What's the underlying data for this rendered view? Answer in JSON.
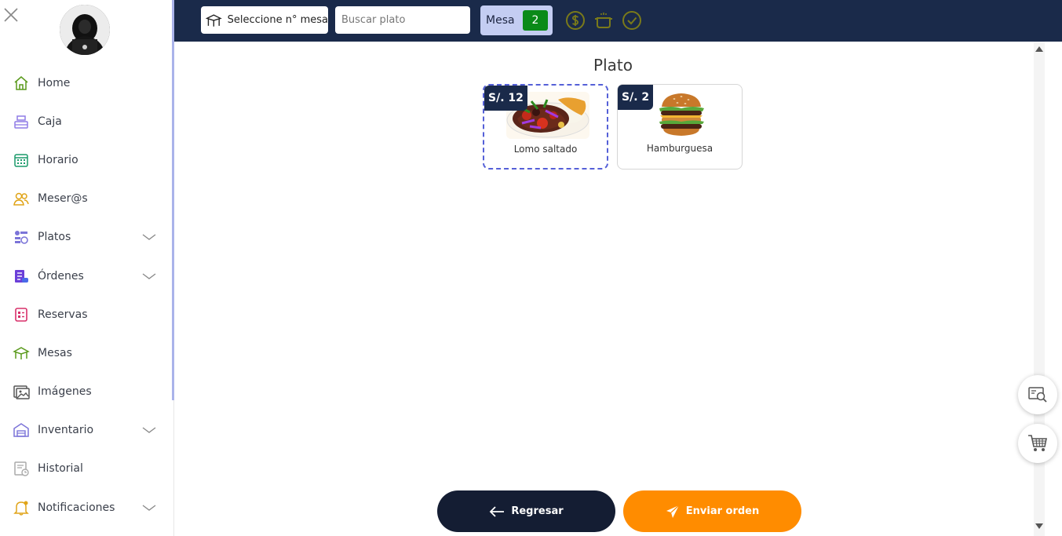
{
  "sidebar": {
    "items": [
      {
        "label": "Home",
        "icon": "home-icon",
        "expandable": false
      },
      {
        "label": "Caja",
        "icon": "cash-register-icon",
        "expandable": false
      },
      {
        "label": "Horario",
        "icon": "calendar-icon",
        "expandable": false
      },
      {
        "label": "Meser@s",
        "icon": "users-icon",
        "expandable": false
      },
      {
        "label": "Platos",
        "icon": "dishes-icon",
        "expandable": true
      },
      {
        "label": "Órdenes",
        "icon": "orders-icon",
        "expandable": true
      },
      {
        "label": "Reservas",
        "icon": "reservations-icon",
        "expandable": false
      },
      {
        "label": "Mesas",
        "icon": "table-icon",
        "expandable": false
      },
      {
        "label": "Imágenes",
        "icon": "images-icon",
        "expandable": false
      },
      {
        "label": "Inventario",
        "icon": "warehouse-icon",
        "expandable": true
      },
      {
        "label": "Historial",
        "icon": "history-icon",
        "expandable": false
      },
      {
        "label": "Notificaciones",
        "icon": "bell-icon",
        "expandable": true
      }
    ]
  },
  "topbar": {
    "table_select_label": "Seleccione n° mesa",
    "search_placeholder": "Buscar plato",
    "mesa_label": "Mesa",
    "mesa_number": "2",
    "status_icons": [
      "dollar-icon",
      "pot-icon",
      "check-circle-icon"
    ]
  },
  "main": {
    "section_title": "Plato",
    "dishes": [
      {
        "price": "S/. 12",
        "name": "Lomo saltado",
        "selected": true
      },
      {
        "price": "S/. 2",
        "name": "Hamburguesa",
        "selected": false
      }
    ],
    "back_label": "Regresar",
    "send_label": "Enviar orden"
  },
  "colors": {
    "topbar": "#1a2a4a",
    "accent_orange": "#ff8c00",
    "mesa_badge": "#0a8a18",
    "selection_border": "#5560d8"
  }
}
